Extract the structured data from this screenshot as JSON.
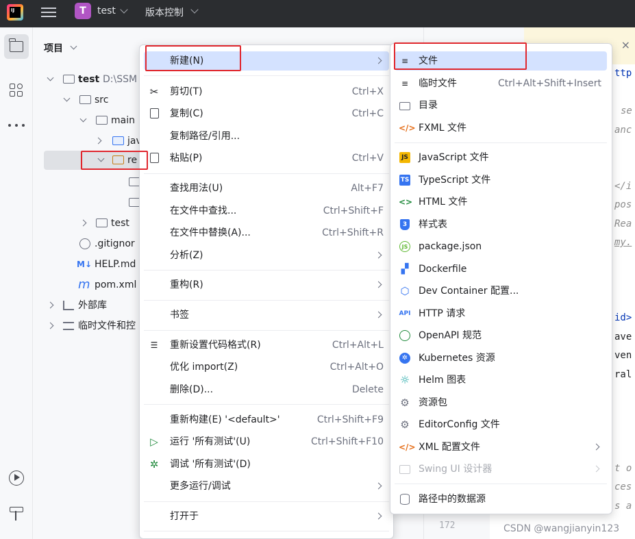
{
  "titlebar": {
    "project_letter": "T",
    "project_name": "test",
    "vcs_label": "版本控制"
  },
  "project_panel": {
    "title": "项目",
    "tree": [
      {
        "label": "test",
        "path": "D:\\SSM"
      },
      {
        "label": "src"
      },
      {
        "label": "main"
      },
      {
        "label": "jav"
      },
      {
        "label": "re"
      },
      {
        "label": "test"
      },
      {
        "label": ".gitignor"
      },
      {
        "label": "HELP.md"
      },
      {
        "label": "pom.xml"
      },
      {
        "label": "外部库"
      },
      {
        "label": "临时文件和控"
      }
    ]
  },
  "editor": {
    "line_number": "172",
    "fragments": [
      "ttp",
      "se",
      "anc",
      "</i",
      "pos",
      "Rea",
      "my.",
      "id>",
      "ave",
      "ven",
      "ral",
      "t o",
      "ces",
      "s a"
    ]
  },
  "context_menu": {
    "items": [
      {
        "label": "新建(N)",
        "shortcut": "",
        "submenu": true
      },
      {
        "label": "剪切(T)",
        "shortcut": "Ctrl+X"
      },
      {
        "label": "复制(C)",
        "shortcut": "Ctrl+C"
      },
      {
        "label": "复制路径/引用...",
        "shortcut": ""
      },
      {
        "label": "粘贴(P)",
        "shortcut": "Ctrl+V"
      },
      {
        "label": "查找用法(U)",
        "shortcut": "Alt+F7"
      },
      {
        "label": "在文件中查找...",
        "shortcut": "Ctrl+Shift+F"
      },
      {
        "label": "在文件中替换(A)...",
        "shortcut": "Ctrl+Shift+R"
      },
      {
        "label": "分析(Z)",
        "shortcut": "",
        "submenu": true
      },
      {
        "label": "重构(R)",
        "shortcut": "",
        "submenu": true
      },
      {
        "label": "书签",
        "shortcut": "",
        "submenu": true
      },
      {
        "label": "重新设置代码格式(R)",
        "shortcut": "Ctrl+Alt+L"
      },
      {
        "label": "优化 import(Z)",
        "shortcut": "Ctrl+Alt+O"
      },
      {
        "label": "删除(D)...",
        "shortcut": "Delete"
      },
      {
        "label": "重新构建(E) '<default>'",
        "shortcut": "Ctrl+Shift+F9"
      },
      {
        "label": "运行 '所有测试'(U)",
        "shortcut": "Ctrl+Shift+F10"
      },
      {
        "label": "调试 '所有测试'(D)",
        "shortcut": ""
      },
      {
        "label": "更多运行/调试",
        "shortcut": "",
        "submenu": true
      },
      {
        "label": "打开于",
        "shortcut": "",
        "submenu": true
      }
    ]
  },
  "new_submenu": {
    "items": [
      {
        "label": "文件",
        "shortcut": "",
        "icon": "file-lines-icon"
      },
      {
        "label": "临时文件",
        "shortcut": "Ctrl+Alt+Shift+Insert",
        "icon": "scratch-file-icon"
      },
      {
        "label": "目录",
        "shortcut": "",
        "icon": "folder-icon"
      },
      {
        "label": "FXML 文件",
        "shortcut": "",
        "icon": "code-brackets-icon"
      },
      {
        "label": "JavaScript 文件",
        "shortcut": "",
        "icon": "js-icon"
      },
      {
        "label": "TypeScript 文件",
        "shortcut": "",
        "icon": "ts-icon"
      },
      {
        "label": "HTML 文件",
        "shortcut": "",
        "icon": "html-icon"
      },
      {
        "label": "样式表",
        "shortcut": "",
        "icon": "css-icon"
      },
      {
        "label": "package.json",
        "shortcut": "",
        "icon": "nodejs-icon"
      },
      {
        "label": "Dockerfile",
        "shortcut": "",
        "icon": "docker-icon"
      },
      {
        "label": "Dev Container 配置...",
        "shortcut": "",
        "icon": "cube-icon"
      },
      {
        "label": "HTTP 请求",
        "shortcut": "",
        "icon": "api-icon"
      },
      {
        "label": "OpenAPI 规范",
        "shortcut": "",
        "icon": "openapi-icon"
      },
      {
        "label": "Kubernetes 资源",
        "shortcut": "",
        "icon": "kubernetes-icon"
      },
      {
        "label": "Helm 图表",
        "shortcut": "",
        "icon": "helm-icon"
      },
      {
        "label": "资源包",
        "shortcut": "",
        "icon": "resource-bundle-icon"
      },
      {
        "label": "EditorConfig 文件",
        "shortcut": "",
        "icon": "editorconfig-icon"
      },
      {
        "label": "XML 配置文件",
        "shortcut": "",
        "icon": "xml-icon",
        "submenu": true
      },
      {
        "label": "Swing UI 设计器",
        "shortcut": "",
        "icon": "swing-icon",
        "submenu": true,
        "disabled": true
      },
      {
        "label": "路径中的数据源",
        "shortcut": "",
        "icon": "database-icon"
      }
    ]
  },
  "watermark": "CSDN @wangjianyin123",
  "colors": {
    "highlight": "#d4e2ff",
    "annotation": "#e0262d",
    "titlebar": "#2b2d30"
  }
}
